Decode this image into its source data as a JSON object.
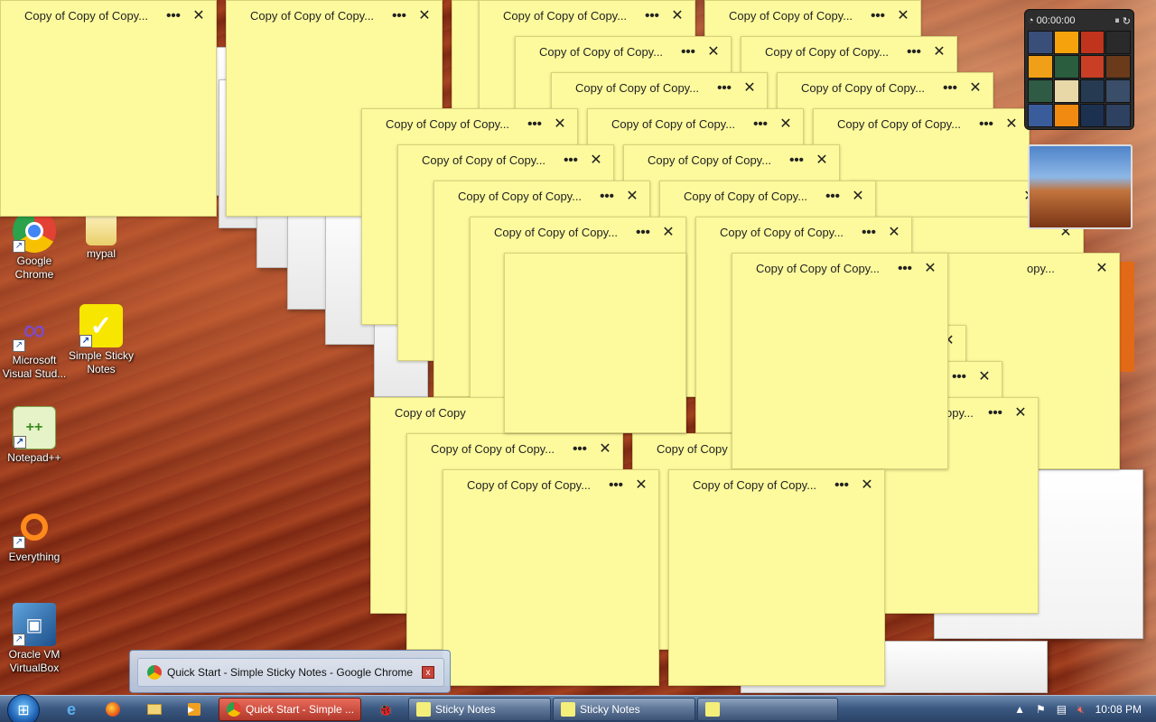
{
  "desktop_icons": [
    {
      "label": "Google\nChrome",
      "icon": "chrome-icon"
    },
    {
      "label": "mypal",
      "icon": "folder-icon"
    },
    {
      "label": "Microsoft\nVisual Stud...",
      "icon": "visual-studio-icon"
    },
    {
      "label": "Simple Sticky\nNotes",
      "icon": "sticky-notes-app-icon"
    },
    {
      "label": "Notepad++",
      "icon": "notepad-plus-icon"
    },
    {
      "label": "Everything",
      "icon": "everything-search-icon"
    },
    {
      "label": "Oracle VM\nVirtualBox",
      "icon": "virtualbox-icon"
    }
  ],
  "notes": {
    "title_full": "Copy of Copy of Copy...",
    "title_cut_1": "Copy of Copy",
    "title_cut_2": "opy...",
    "title_cut_3": "py",
    "title_cut_4": "opy...",
    "more": "•••",
    "close": "✕"
  },
  "gadgets": {
    "puzzle_timer": "00:00:00"
  },
  "thumbnail_tooltip": {
    "title": "Quick Start - Simple Sticky Notes - Google Chrome",
    "close": "x"
  },
  "taskbar": {
    "tasks": [
      {
        "label": "Quick Start - Simple ...",
        "active": true
      },
      {
        "label": "Sticky Notes"
      },
      {
        "label": "Sticky Notes"
      }
    ],
    "clock": "10:08 PM"
  },
  "colors": {
    "note_bg": "#fdfa9d",
    "taskbar_active": "#b2392c"
  }
}
